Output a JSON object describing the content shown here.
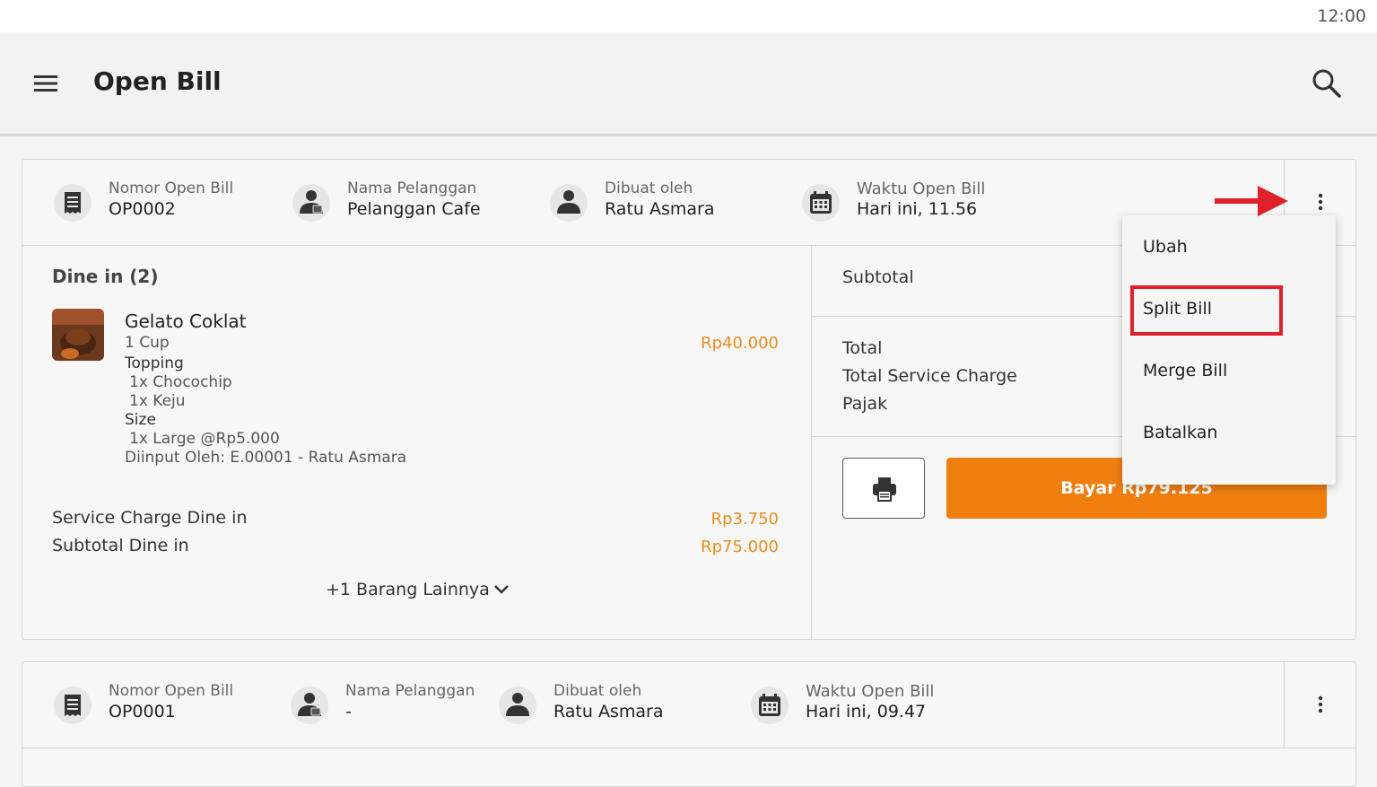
{
  "status_bar": {
    "time": "12:00"
  },
  "app_bar": {
    "title": "Open Bill"
  },
  "bills": [
    {
      "nomor_label": "Nomor Open Bill",
      "nomor": "OP0002",
      "pelanggan_label": "Nama Pelanggan",
      "pelanggan": "Pelanggan Cafe",
      "dibuat_label": "Dibuat oleh",
      "dibuat": "Ratu Asmara",
      "waktu_label": "Waktu Open Bill",
      "waktu": "Hari ini, 11.56",
      "section_title": "Dine in (2)",
      "item": {
        "name": "Gelato Coklat",
        "qty": "1 Cup",
        "price": "Rp40.000",
        "topping_label": "Topping",
        "topping_1": "1x Chocochip",
        "topping_2": "1x Keju",
        "size_label": "Size",
        "size_1": "1x Large @Rp5.000",
        "entered_by": "Diinput Oleh:  E.00001 - Ratu Asmara"
      },
      "service_charge_label": "Service Charge Dine in",
      "service_charge": "Rp3.750",
      "subtotal_label": "Subtotal Dine in",
      "subtotal": "Rp75.000",
      "more_items": "+1 Barang Lainnya",
      "summary": {
        "subtotal_label": "Subtotal",
        "total_label": "Total",
        "service_label": "Total Service Charge",
        "pajak_label": "Pajak"
      },
      "pay_label": "Bayar Rp79.125"
    },
    {
      "nomor_label": "Nomor Open Bill",
      "nomor": "OP0001",
      "pelanggan_label": "Nama Pelanggan",
      "pelanggan": "-",
      "dibuat_label": "Dibuat oleh",
      "dibuat": "Ratu Asmara",
      "waktu_label": "Waktu Open Bill",
      "waktu": "Hari ini, 09.47"
    }
  ],
  "menu": {
    "items": [
      "Ubah",
      "Split Bill",
      "Merge Bill",
      "Batalkan"
    ]
  },
  "colors": {
    "accent": "#f07f10",
    "price": "#f08a1c",
    "highlight": "#e0202a"
  },
  "icons": [
    "menu-icon",
    "search-icon",
    "receipt-icon",
    "customer-icon",
    "person-icon",
    "calendar-icon",
    "more-vert-icon",
    "chevron-down-icon",
    "printer-icon",
    "arrow-right-icon"
  ]
}
